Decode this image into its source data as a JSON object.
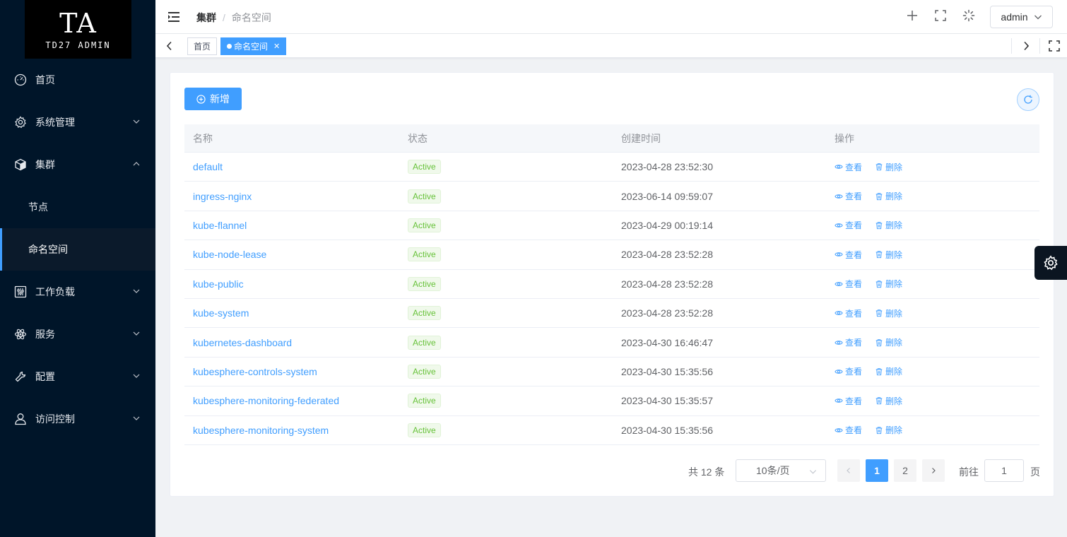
{
  "logo": {
    "mark": "TA",
    "text": "TD27 ADMIN"
  },
  "sidebar": {
    "items": [
      {
        "label": "首页",
        "icon": "dashboard-icon"
      },
      {
        "label": "系统管理",
        "icon": "gear-icon"
      },
      {
        "label": "集群",
        "icon": "cube-icon"
      },
      {
        "label": "节点"
      },
      {
        "label": "命名空间"
      },
      {
        "label": "工作负载",
        "icon": "sliders-icon"
      },
      {
        "label": "服务",
        "icon": "atom-icon"
      },
      {
        "label": "配置",
        "icon": "wrench-icon"
      },
      {
        "label": "访问控制",
        "icon": "user-icon"
      }
    ]
  },
  "header": {
    "breadcrumb": [
      "集群",
      "命名空间"
    ],
    "breadcrumb_sep": "/",
    "user": "admin"
  },
  "tags": [
    {
      "label": "首页"
    },
    {
      "label": "命名空间",
      "active": true
    }
  ],
  "toolbar": {
    "add_label": "新增"
  },
  "table": {
    "columns": [
      "名称",
      "状态",
      "创建时间",
      "操作"
    ],
    "rows": [
      {
        "name": "default",
        "status": "Active",
        "created": "2023-04-28 23:52:30"
      },
      {
        "name": "ingress-nginx",
        "status": "Active",
        "created": "2023-06-14 09:59:07"
      },
      {
        "name": "kube-flannel",
        "status": "Active",
        "created": "2023-04-29 00:19:14"
      },
      {
        "name": "kube-node-lease",
        "status": "Active",
        "created": "2023-04-28 23:52:28"
      },
      {
        "name": "kube-public",
        "status": "Active",
        "created": "2023-04-28 23:52:28"
      },
      {
        "name": "kube-system",
        "status": "Active",
        "created": "2023-04-28 23:52:28"
      },
      {
        "name": "kubernetes-dashboard",
        "status": "Active",
        "created": "2023-04-30 16:46:47"
      },
      {
        "name": "kubesphere-controls-system",
        "status": "Active",
        "created": "2023-04-30 15:35:56"
      },
      {
        "name": "kubesphere-monitoring-federated",
        "status": "Active",
        "created": "2023-04-30 15:35:57"
      },
      {
        "name": "kubesphere-monitoring-system",
        "status": "Active",
        "created": "2023-04-30 15:35:56"
      }
    ],
    "actions": {
      "view": "查看",
      "delete": "删除"
    }
  },
  "pagination": {
    "total": "共 12 条",
    "page_size": "10条/页",
    "pages": [
      "1",
      "2"
    ],
    "current": "1",
    "goto_label": "前往",
    "goto_value": "1",
    "page_label": "页"
  },
  "colors": {
    "primary": "#409eff",
    "sidebar": "#001529",
    "success": "#67c23a"
  }
}
